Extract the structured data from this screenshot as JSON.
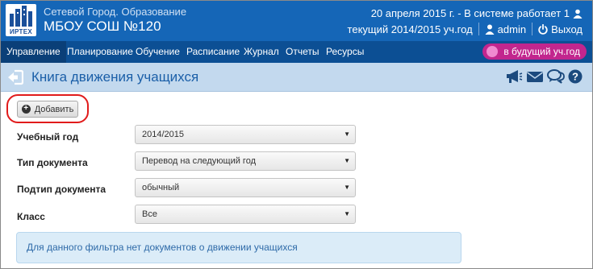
{
  "header": {
    "logo_text": "ИРТЕХ",
    "org_subtitle": "Сетевой Город. Образование",
    "org_name": "МБОУ СОШ №120",
    "status_line": "20 апреля 2015 г. - В системе работает 1",
    "current_year": "текущий 2014/2015 уч.год",
    "user": "admin",
    "logout": "Выход"
  },
  "nav": {
    "items": [
      {
        "label": "Управление"
      },
      {
        "label": "Планирование"
      },
      {
        "label": "Обучение"
      },
      {
        "label": "Расписание"
      },
      {
        "label": "Журнал"
      },
      {
        "label": "Отчеты"
      },
      {
        "label": "Ресурсы"
      }
    ],
    "active_index": 0,
    "future_year_label": "в будущий уч.год"
  },
  "page": {
    "title": "Книга движения учащихся",
    "add_button": "Добавить"
  },
  "form": {
    "fields": [
      {
        "label": "Учебный год",
        "value": "2014/2015"
      },
      {
        "label": "Тип документа",
        "value": "Перевод на следующий год"
      },
      {
        "label": "Подтип документа",
        "value": "обычный"
      },
      {
        "label": "Класс",
        "value": "Все"
      }
    ]
  },
  "alert": {
    "message": "Для данного фильтра нет документов о движении учащихся"
  },
  "icons": {
    "back": "arrow-left-circle-icon",
    "megaphone": "megaphone-icon",
    "mail": "envelope-icon",
    "chat": "chat-icon",
    "help": "help-icon",
    "user": "user-icon",
    "power": "power-icon"
  },
  "colors": {
    "header": "#1566b7",
    "nav": "#0c4f94",
    "future_button": "#c2268e",
    "titlebar": "#c3d9ee",
    "alert_bg": "#dbecf8",
    "highlight_ring": "#e11b1b"
  }
}
